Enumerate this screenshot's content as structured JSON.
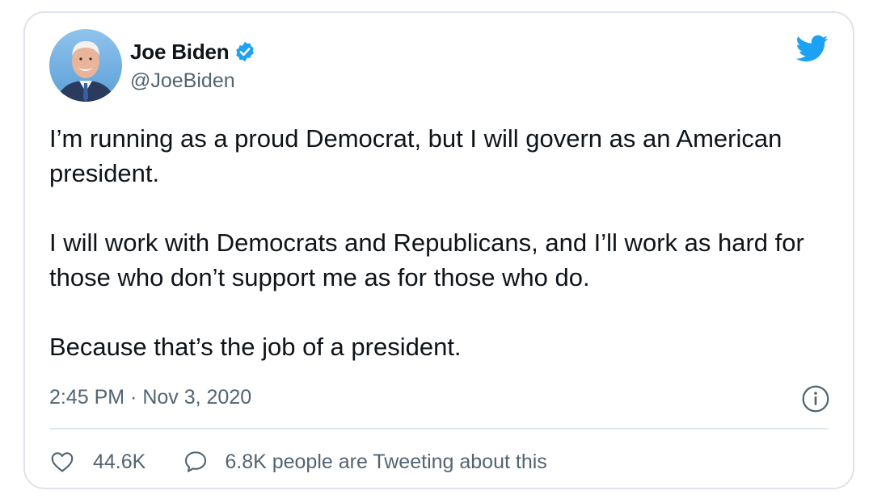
{
  "author": {
    "name": "Joe Biden",
    "handle": "@JoeBiden",
    "verified": true,
    "avatar_icon": "avatar-photo"
  },
  "tweet": {
    "paragraphs": [
      "I’m running as a proud Democrat, but I will govern as an American president.",
      "I will work with Democrats and Republicans, and I’ll work as hard for those who don’t support me as for those who do.",
      "Because that’s the job of a president."
    ],
    "timestamp": "2:45 PM · Nov 3, 2020"
  },
  "actions": {
    "likes": "44.6K",
    "tweeting": "6.8K people are Tweeting about this"
  },
  "icons": {
    "brand": "twitter-bird-icon",
    "verified": "verified-badge-icon",
    "info": "info-icon",
    "like": "heart-icon",
    "reply": "speech-bubble-icon"
  },
  "colors": {
    "brand_blue": "#1da1f2",
    "text_primary": "#0f1419",
    "text_secondary": "#536471",
    "border": "#dde3e8"
  }
}
